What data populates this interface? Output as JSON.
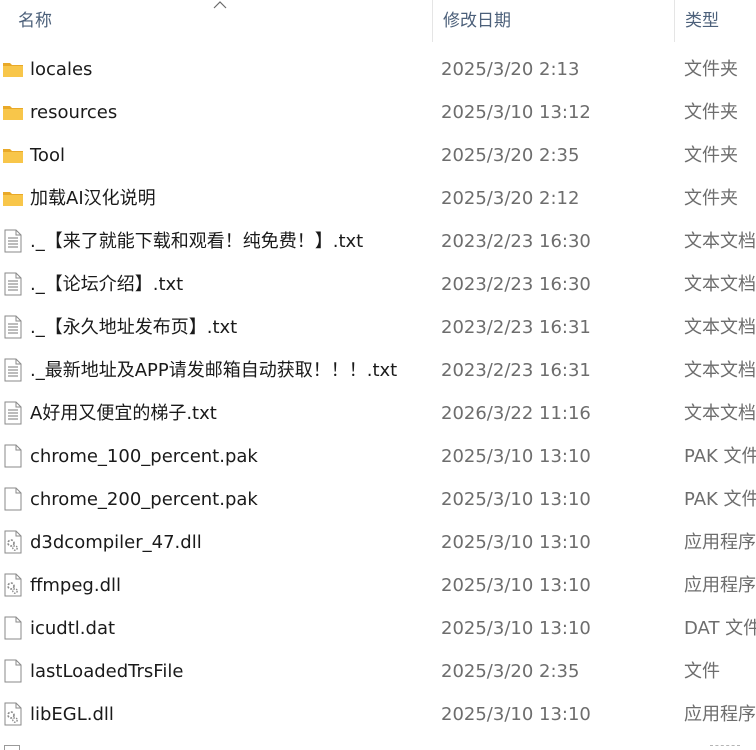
{
  "header": {
    "name_label": "名称",
    "date_label": "修改日期",
    "type_label": "类型",
    "sort_indicator": "sort-ascending-arrow"
  },
  "files": [
    {
      "name": "locales",
      "date": "2025/3/20 2:13",
      "type": "文件夹",
      "icon": "folder"
    },
    {
      "name": "resources",
      "date": "2025/3/10 13:12",
      "type": "文件夹",
      "icon": "folder"
    },
    {
      "name": "Tool",
      "date": "2025/3/20 2:35",
      "type": "文件夹",
      "icon": "folder"
    },
    {
      "name": "加载AI汉化说明",
      "date": "2025/3/20 2:12",
      "type": "文件夹",
      "icon": "folder"
    },
    {
      "name": "._【来了就能下载和观看！纯免费！】.txt",
      "date": "2023/2/23 16:30",
      "type": "文本文档",
      "icon": "text"
    },
    {
      "name": "._【论坛介绍】.txt",
      "date": "2023/2/23 16:30",
      "type": "文本文档",
      "icon": "text"
    },
    {
      "name": "._【永久地址发布页】.txt",
      "date": "2023/2/23 16:31",
      "type": "文本文档",
      "icon": "text"
    },
    {
      "name": "._最新地址及APP请发邮箱自动获取！！！.txt",
      "date": "2023/2/23 16:31",
      "type": "文本文档",
      "icon": "text"
    },
    {
      "name": "A好用又便宜的梯子.txt",
      "date": "2026/3/22 11:16",
      "type": "文本文档",
      "icon": "text"
    },
    {
      "name": "chrome_100_percent.pak",
      "date": "2025/3/10 13:10",
      "type": "PAK 文件",
      "icon": "file"
    },
    {
      "name": "chrome_200_percent.pak",
      "date": "2025/3/10 13:10",
      "type": "PAK 文件",
      "icon": "file"
    },
    {
      "name": "d3dcompiler_47.dll",
      "date": "2025/3/10 13:10",
      "type": "应用程序扩展",
      "icon": "dll"
    },
    {
      "name": "ffmpeg.dll",
      "date": "2025/3/10 13:10",
      "type": "应用程序扩展",
      "icon": "dll"
    },
    {
      "name": "icudtl.dat",
      "date": "2025/3/10 13:10",
      "type": "DAT 文件",
      "icon": "file"
    },
    {
      "name": "lastLoadedTrsFile",
      "date": "2025/3/20 2:35",
      "type": "文件",
      "icon": "file"
    },
    {
      "name": "libEGL.dll",
      "date": "2025/3/10 13:10",
      "type": "应用程序扩展",
      "icon": "dll"
    }
  ],
  "colors": {
    "header_text": "#4c607a",
    "name_text": "#1a1a1a",
    "meta_text": "#6d6d6d",
    "folder_fill": "#f8c64a",
    "folder_back": "#e9a928"
  }
}
